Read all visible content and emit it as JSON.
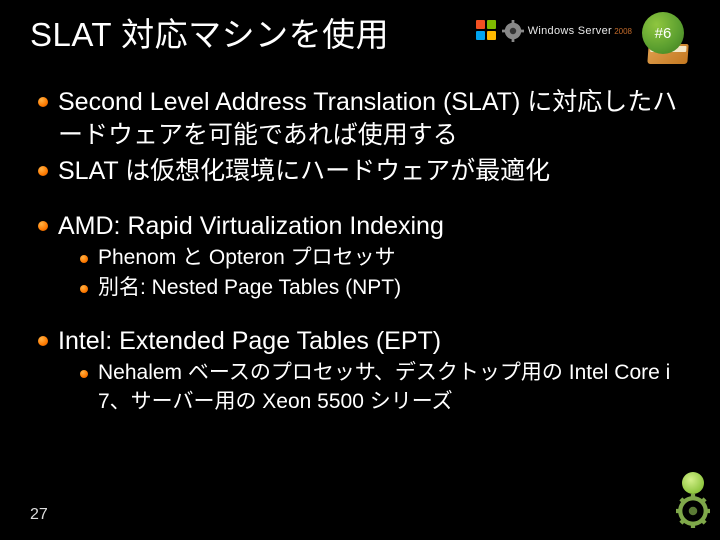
{
  "title": "SLAT 対応マシンを使用",
  "badge": "#6",
  "logo_text": "Windows Server",
  "logo_sub": " 2008",
  "bullets": {
    "b1": "Second Level Address Translation (SLAT) に対応したハードウェアを可能であれば使用する",
    "b2": "SLAT は仮想化環境にハードウェアが最適化",
    "b3": "AMD: Rapid Virtualization Indexing",
    "b3_sub": {
      "s1": "Phenom と Opteron プロセッサ",
      "s2": "別名: Nested Page Tables (NPT)"
    },
    "b4": "Intel: Extended Page Tables (EPT)",
    "b4_sub": {
      "s1": "Nehalem ベースのプロセッサ、デスクトップ用の Intel Core i 7、サーバー用の Xeon 5500 シリーズ"
    }
  },
  "page_number": "27"
}
